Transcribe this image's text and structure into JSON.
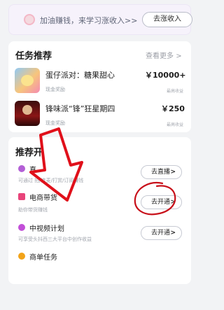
{
  "banner": {
    "text": "加油赚钱，来学习涨收入>>",
    "button": "去涨收入"
  },
  "tasks": {
    "title": "任务推荐",
    "more": "查看更多",
    "more_chevron": ">",
    "items": [
      {
        "title": "蛋仔派对：糖果甜心",
        "reward_type": "现金奖励",
        "price": "￥10000+",
        "note": "最高收益"
      },
      {
        "title": "锋味派“锋”狂星期四",
        "reward_type": "现金奖励",
        "price": "￥250",
        "note": "最高收益"
      }
    ]
  },
  "recommend": {
    "title_visible": "推荐开",
    "items": [
      {
        "title": "直",
        "desc": "可通过  拍/连麦/打赏/订阅赚钱",
        "button": "去直播",
        "icon_color": "#b35fd6"
      },
      {
        "title": "电商带货",
        "desc": "助你带货赚钱",
        "button": "去开通",
        "icon_color": "#e8447a"
      },
      {
        "title": "中视频计划",
        "desc": "可享受头抖西三大平台中创作收益",
        "button": "去开通",
        "icon_color": "#c24fd8"
      },
      {
        "title": "商单任务",
        "desc": "",
        "button": "",
        "icon_color": "#f2a319"
      }
    ],
    "chevron": ">"
  },
  "annotations": {
    "arrow_color": "#e0101a",
    "circle_color": "#c8101a"
  }
}
